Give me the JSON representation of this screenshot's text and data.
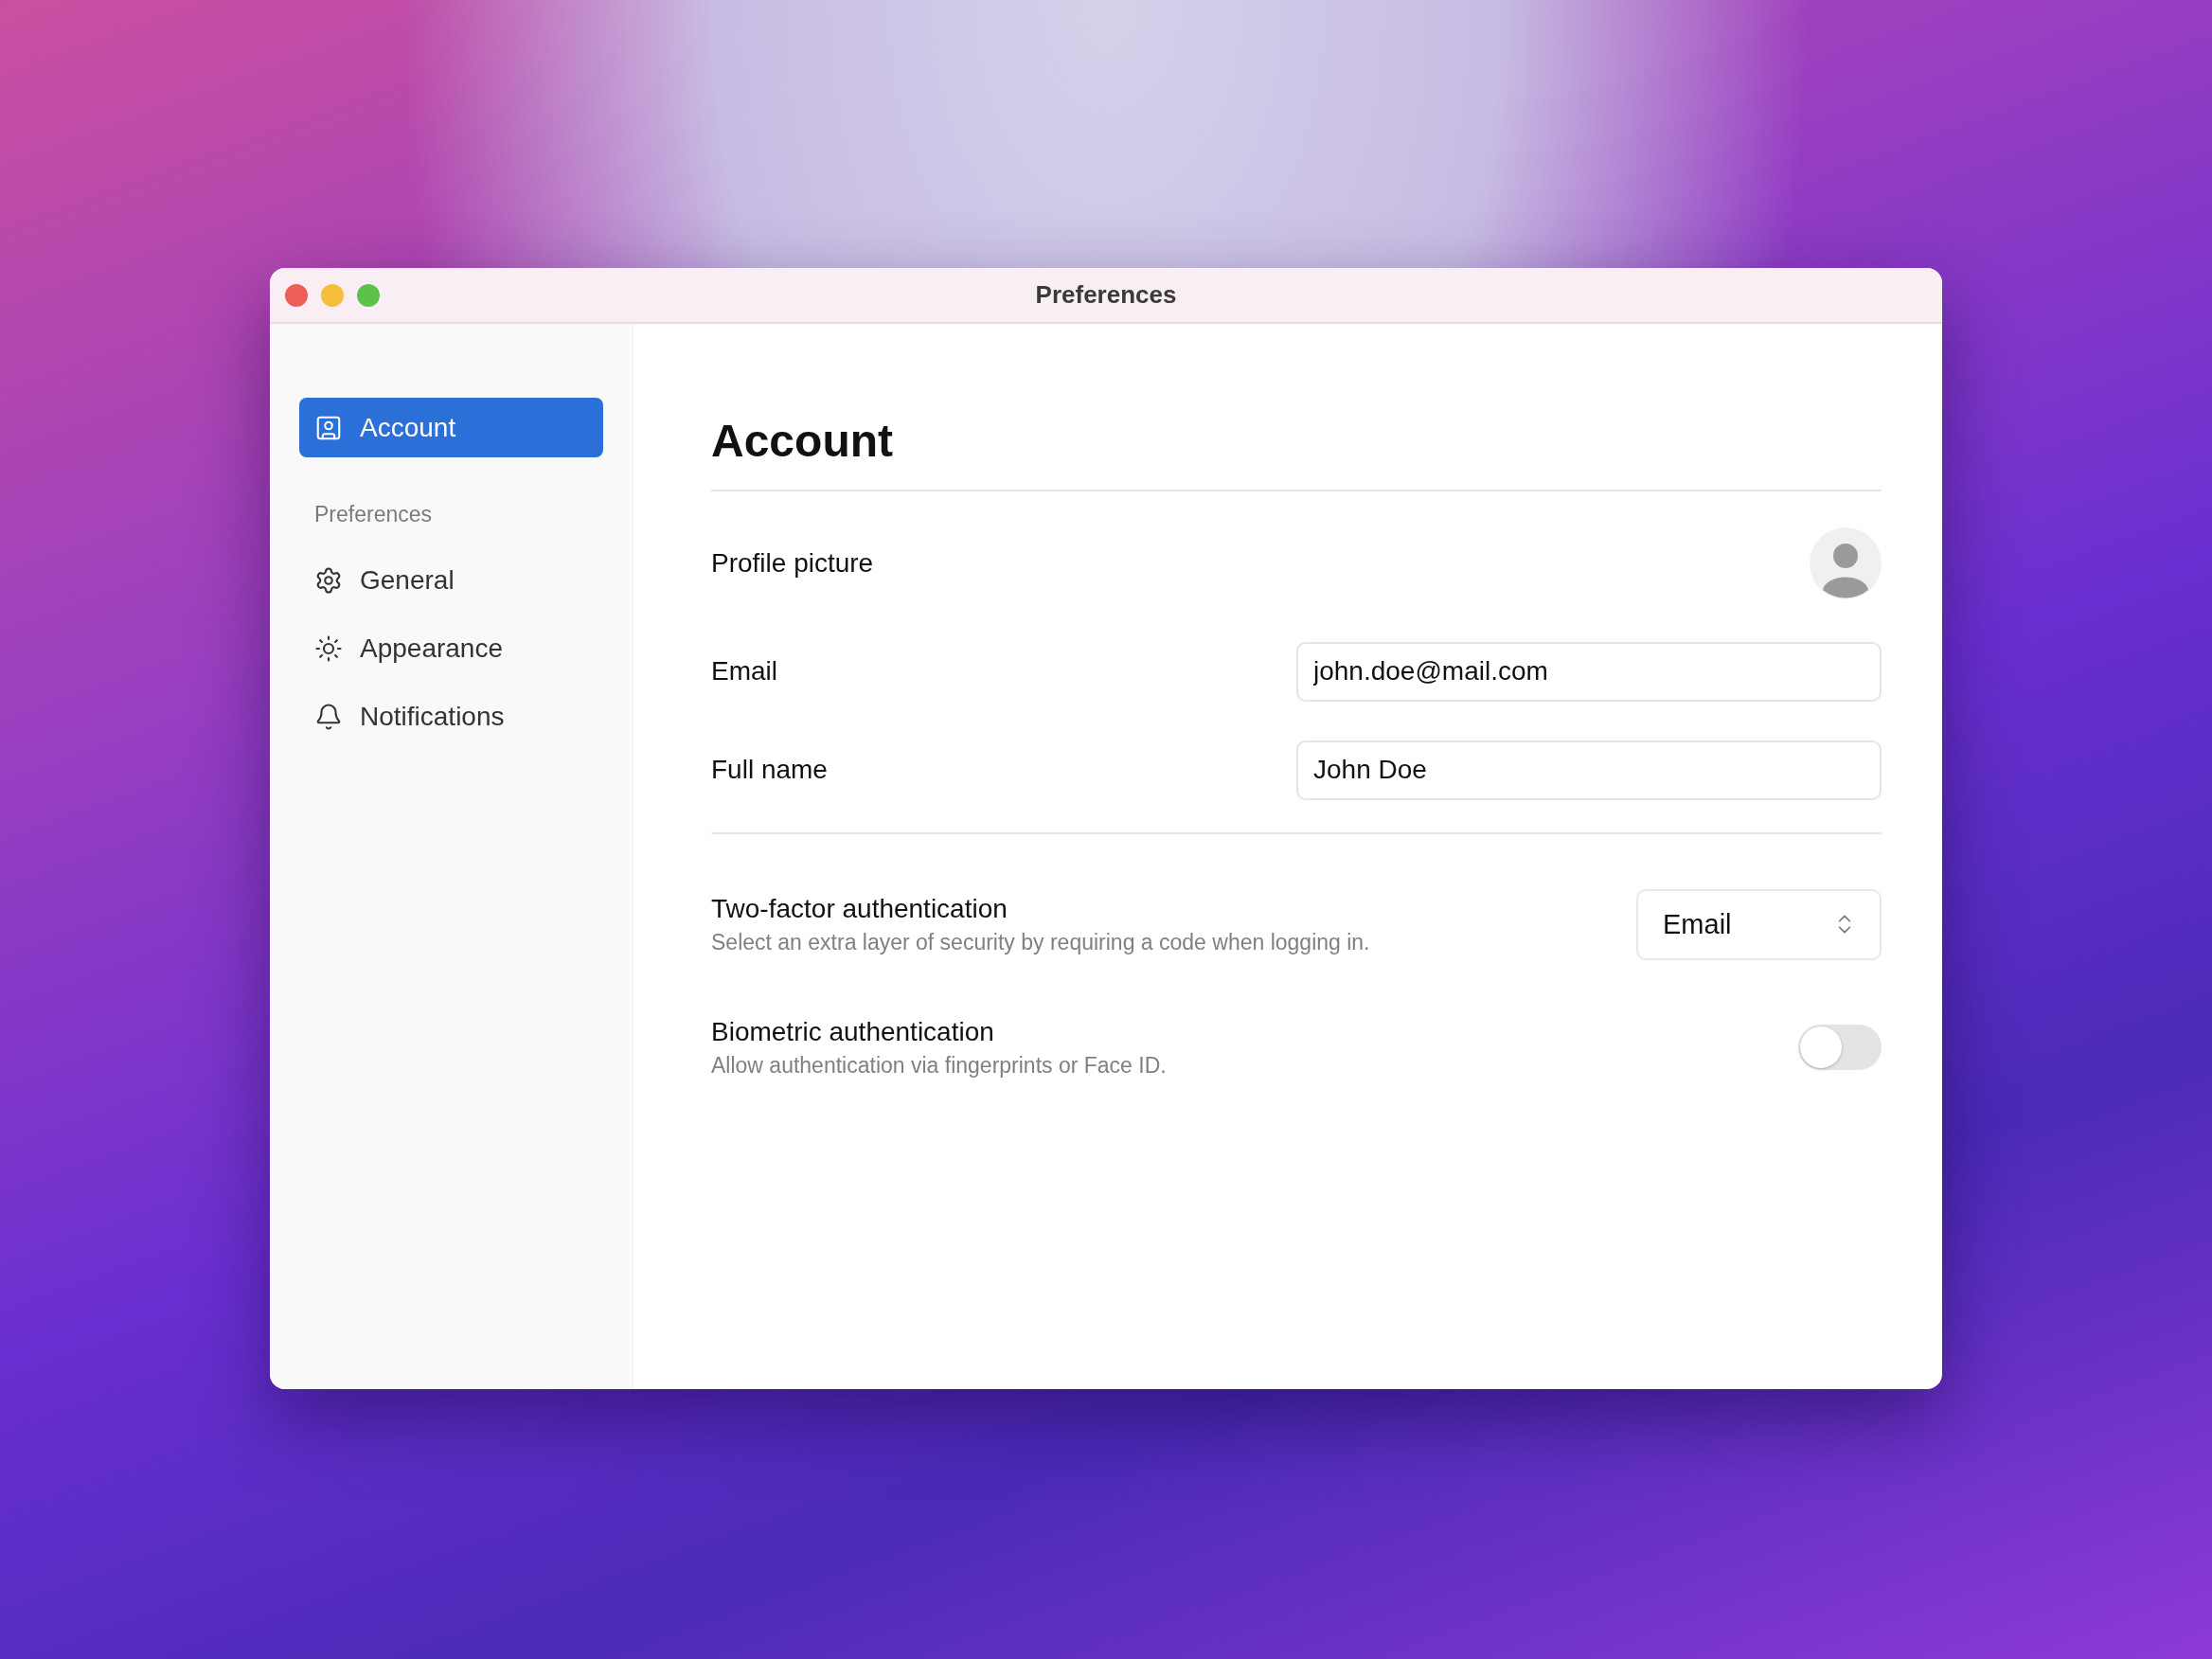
{
  "window": {
    "title": "Preferences"
  },
  "sidebar": {
    "top_items": [
      {
        "label": "Account",
        "selected": true
      }
    ],
    "section_title": "Preferences",
    "items": [
      {
        "label": "General",
        "selected": false
      },
      {
        "label": "Appearance",
        "selected": false
      },
      {
        "label": "Notifications",
        "selected": false
      }
    ]
  },
  "content": {
    "heading": "Account",
    "profile_rows": [
      {
        "kind": "avatar",
        "label": "Profile picture"
      },
      {
        "kind": "field",
        "label": "Email",
        "value": "john.doe@mail.com"
      },
      {
        "kind": "field",
        "label": "Full name",
        "value": "John Doe"
      }
    ],
    "security_rows": [
      {
        "kind": "select",
        "label": "Two-factor authentication",
        "description": "Select an extra layer of security by requiring a code when logging in.",
        "value": "Email"
      },
      {
        "kind": "toggle",
        "label": "Biometric authentication",
        "description": "Allow authentication via fingerprints or Face ID.",
        "on": false
      }
    ]
  }
}
